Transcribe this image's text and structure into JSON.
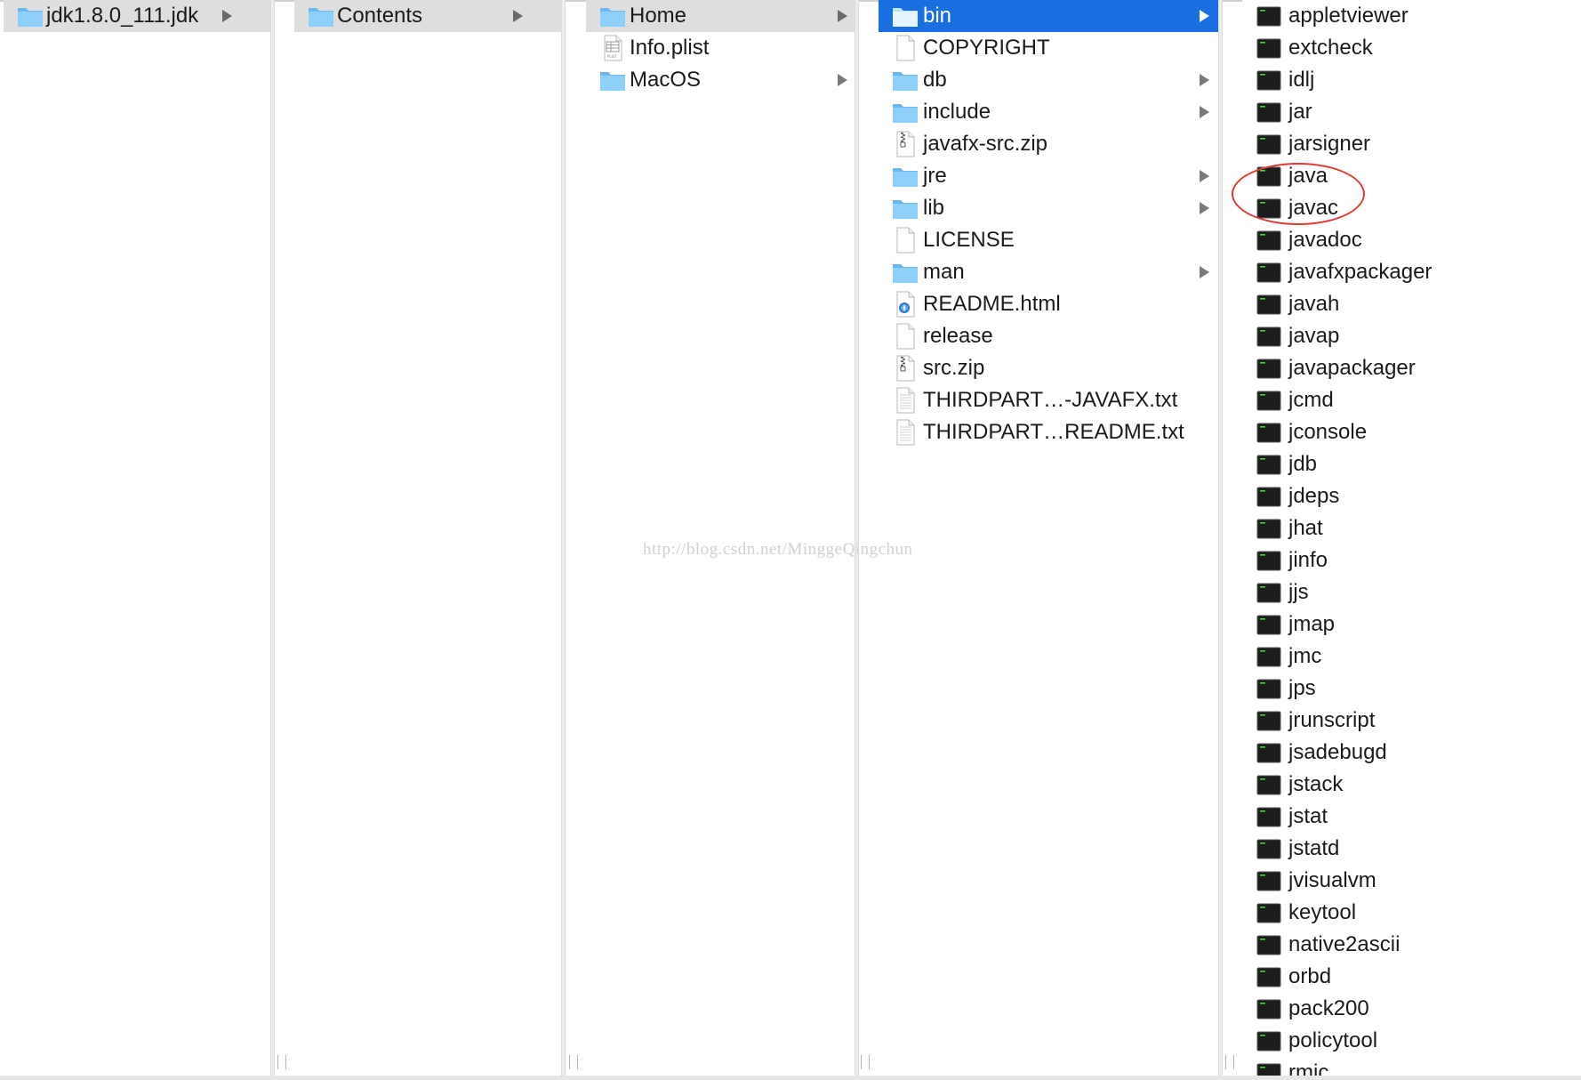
{
  "columns": [
    {
      "items": [
        {
          "label": "jdk1.8.0_111.jdk",
          "icon": "folder-icon",
          "arrow": true,
          "state": "gray"
        }
      ]
    },
    {
      "items": [
        {
          "label": "Contents",
          "icon": "folder-icon",
          "arrow": true,
          "state": "gray"
        }
      ]
    },
    {
      "items": [
        {
          "label": "Home",
          "icon": "folder-icon",
          "arrow": true,
          "state": "gray"
        },
        {
          "label": "Info.plist",
          "icon": "plist-file-icon",
          "arrow": false,
          "state": ""
        },
        {
          "label": "MacOS",
          "icon": "folder-icon",
          "arrow": true,
          "state": ""
        }
      ]
    },
    {
      "items": [
        {
          "label": "bin",
          "icon": "folder-icon",
          "arrow": true,
          "state": "blue"
        },
        {
          "label": "COPYRIGHT",
          "icon": "document-icon",
          "arrow": false,
          "state": ""
        },
        {
          "label": "db",
          "icon": "folder-icon",
          "arrow": true,
          "state": ""
        },
        {
          "label": "include",
          "icon": "folder-icon",
          "arrow": true,
          "state": ""
        },
        {
          "label": "javafx-src.zip",
          "icon": "zip-file-icon",
          "arrow": false,
          "state": ""
        },
        {
          "label": "jre",
          "icon": "folder-icon",
          "arrow": true,
          "state": ""
        },
        {
          "label": "lib",
          "icon": "folder-icon",
          "arrow": true,
          "state": ""
        },
        {
          "label": "LICENSE",
          "icon": "document-icon",
          "arrow": false,
          "state": ""
        },
        {
          "label": "man",
          "icon": "folder-icon",
          "arrow": true,
          "state": ""
        },
        {
          "label": "README.html",
          "icon": "html-file-icon",
          "arrow": false,
          "state": ""
        },
        {
          "label": "release",
          "icon": "document-icon",
          "arrow": false,
          "state": ""
        },
        {
          "label": "src.zip",
          "icon": "zip-file-icon",
          "arrow": false,
          "state": ""
        },
        {
          "label": "THIRDPART…-JAVAFX.txt",
          "icon": "text-file-icon",
          "arrow": false,
          "state": ""
        },
        {
          "label": "THIRDPART…README.txt",
          "icon": "text-file-icon",
          "arrow": false,
          "state": ""
        }
      ]
    },
    {
      "items": [
        {
          "label": "appletviewer",
          "icon": "terminal-exec-icon"
        },
        {
          "label": "extcheck",
          "icon": "terminal-exec-icon"
        },
        {
          "label": "idlj",
          "icon": "terminal-exec-icon"
        },
        {
          "label": "jar",
          "icon": "terminal-exec-icon"
        },
        {
          "label": "jarsigner",
          "icon": "terminal-exec-icon"
        },
        {
          "label": "java",
          "icon": "terminal-exec-icon"
        },
        {
          "label": "javac",
          "icon": "terminal-exec-icon"
        },
        {
          "label": "javadoc",
          "icon": "terminal-exec-icon"
        },
        {
          "label": "javafxpackager",
          "icon": "terminal-exec-icon"
        },
        {
          "label": "javah",
          "icon": "terminal-exec-icon"
        },
        {
          "label": "javap",
          "icon": "terminal-exec-icon"
        },
        {
          "label": "javapackager",
          "icon": "terminal-exec-icon"
        },
        {
          "label": "jcmd",
          "icon": "terminal-exec-icon"
        },
        {
          "label": "jconsole",
          "icon": "terminal-exec-icon"
        },
        {
          "label": "jdb",
          "icon": "terminal-exec-icon"
        },
        {
          "label": "jdeps",
          "icon": "terminal-exec-icon"
        },
        {
          "label": "jhat",
          "icon": "terminal-exec-icon"
        },
        {
          "label": "jinfo",
          "icon": "terminal-exec-icon"
        },
        {
          "label": "jjs",
          "icon": "terminal-exec-icon"
        },
        {
          "label": "jmap",
          "icon": "terminal-exec-icon"
        },
        {
          "label": "jmc",
          "icon": "terminal-exec-icon"
        },
        {
          "label": "jps",
          "icon": "terminal-exec-icon"
        },
        {
          "label": "jrunscript",
          "icon": "terminal-exec-icon"
        },
        {
          "label": "jsadebugd",
          "icon": "terminal-exec-icon"
        },
        {
          "label": "jstack",
          "icon": "terminal-exec-icon"
        },
        {
          "label": "jstat",
          "icon": "terminal-exec-icon"
        },
        {
          "label": "jstatd",
          "icon": "terminal-exec-icon"
        },
        {
          "label": "jvisualvm",
          "icon": "terminal-exec-icon"
        },
        {
          "label": "keytool",
          "icon": "terminal-exec-icon"
        },
        {
          "label": "native2ascii",
          "icon": "terminal-exec-icon"
        },
        {
          "label": "orbd",
          "icon": "terminal-exec-icon"
        },
        {
          "label": "pack200",
          "icon": "terminal-exec-icon"
        },
        {
          "label": "policytool",
          "icon": "terminal-exec-icon"
        },
        {
          "label": "rmic",
          "icon": "terminal-exec-icon"
        }
      ]
    }
  ],
  "watermark": "http://blog.csdn.net/MinggeQingchun",
  "colors": {
    "selection_blue": "#1a6fe0",
    "selection_gray": "#dedede",
    "folder_blue": "#79c6f5",
    "annotation_red": "#e03a32"
  }
}
